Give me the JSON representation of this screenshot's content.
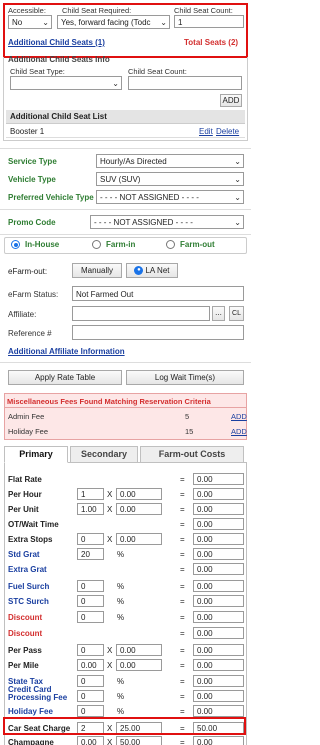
{
  "child_seat_top": {
    "accessible_label": "Accessible:",
    "accessible_value": "No",
    "required_label": "Child Seat Required:",
    "required_value": "Yes, forward facing (Todc",
    "count_label": "Child Seat Count:",
    "count_value": "1",
    "additional_link": "Additional Child Seats (1)",
    "total_seats": "Total Seats (2)"
  },
  "additional_child_seats": {
    "info_header": "Additional Child Seats Info",
    "type_label": "Child Seat Type:",
    "count_label": "Child Seat Count:",
    "add_button": "ADD",
    "list_header": "Additional Child Seat List",
    "items": [
      {
        "name": "Booster 1",
        "edit": "Edit",
        "delete": "Delete"
      }
    ]
  },
  "service": {
    "service_type_label": "Service Type",
    "service_type_value": "Hourly/As Directed",
    "vehicle_type_label": "Vehicle Type",
    "vehicle_type_value": "SUV (SUV)",
    "preferred_vehicle_label": "Preferred Vehicle Type",
    "preferred_vehicle_value": "- - - - NOT ASSIGNED - - - -",
    "promo_label": "Promo Code",
    "promo_value": "- - - - NOT ASSIGNED - - - -"
  },
  "farm_radio": {
    "options": [
      "In-House",
      "Farm-in",
      "Farm-out"
    ],
    "selected": "In-House"
  },
  "efarm": {
    "efarm_out_label": "eFarm-out:",
    "manually_button": "Manually",
    "la_net_button": "LA Net",
    "status_label": "eFarm Status:",
    "status_value": "Not Farmed Out",
    "affiliate_label": "Affiliate:",
    "affiliate_more": "...",
    "affiliate_cl": "CL",
    "reference_label": "Reference #",
    "additional_affiliate_link": "Additional Affiliate Information"
  },
  "rate_buttons": {
    "apply": "Apply Rate Table",
    "log_wait": "Log Wait Time(s)"
  },
  "misc_fees": {
    "header": "Miscellaneous Fees Found Matching Reservation Criteria",
    "fees": [
      {
        "name": "Admin Fee",
        "value": "5",
        "action": "ADD"
      },
      {
        "name": "Holiday Fee",
        "value": "15",
        "action": "ADD"
      }
    ]
  },
  "tabs": [
    "Primary",
    "Secondary",
    "Farm-out Costs"
  ],
  "rates": {
    "x_symbol": "X",
    "pct_symbol": "%",
    "eq_symbol": "=",
    "rows": [
      {
        "label": "Flat Rate",
        "result": "0.00"
      },
      {
        "label": "Per Hour",
        "qty": "1",
        "rate": "0.00",
        "result": "0.00"
      },
      {
        "label": "Per Unit",
        "qty": "1.00",
        "rate": "0.00",
        "result": "0.00"
      },
      {
        "label": "OT/Wait Time",
        "result": "0.00"
      },
      {
        "label": "Extra Stops",
        "qty": "0",
        "rate": "0.00",
        "result": "0.00"
      },
      {
        "label": "Std Grat",
        "qty": "20",
        "result": "0.00"
      },
      {
        "label": "Extra Grat",
        "result": "0.00"
      },
      {
        "label": "Fuel Surch",
        "qty": "0",
        "result": "0.00"
      },
      {
        "label": "STC Surch",
        "qty": "0",
        "result": "0.00"
      },
      {
        "label": "Discount",
        "qty": "0",
        "result": "0.00"
      },
      {
        "label": "Discount",
        "result": "0.00"
      },
      {
        "label": "Per Pass",
        "qty": "0",
        "rate": "0.00",
        "result": "0.00"
      },
      {
        "label": "Per Mile",
        "qty": "0.00",
        "rate": "0.00",
        "result": "0.00"
      },
      {
        "label": "State Tax",
        "qty": "0",
        "result": "0.00"
      },
      {
        "label": "Credit Card Processing Fee",
        "qty": "0",
        "result": "0.00"
      },
      {
        "label": "Holiday Fee",
        "qty": "0",
        "result": "0.00"
      },
      {
        "label": "Car Seat Charge",
        "qty": "2",
        "rate": "25.00",
        "result": "50.00"
      },
      {
        "label": "Champagne",
        "qty": "0.00",
        "rate": "50.00",
        "result": "0.00"
      }
    ]
  },
  "colors": {
    "red_highlight": "#e01010",
    "link_blue": "#1a3fa0",
    "green_label": "#2e7d32",
    "red_label": "#d32f2f",
    "misc_bg": "#fde7e7"
  }
}
